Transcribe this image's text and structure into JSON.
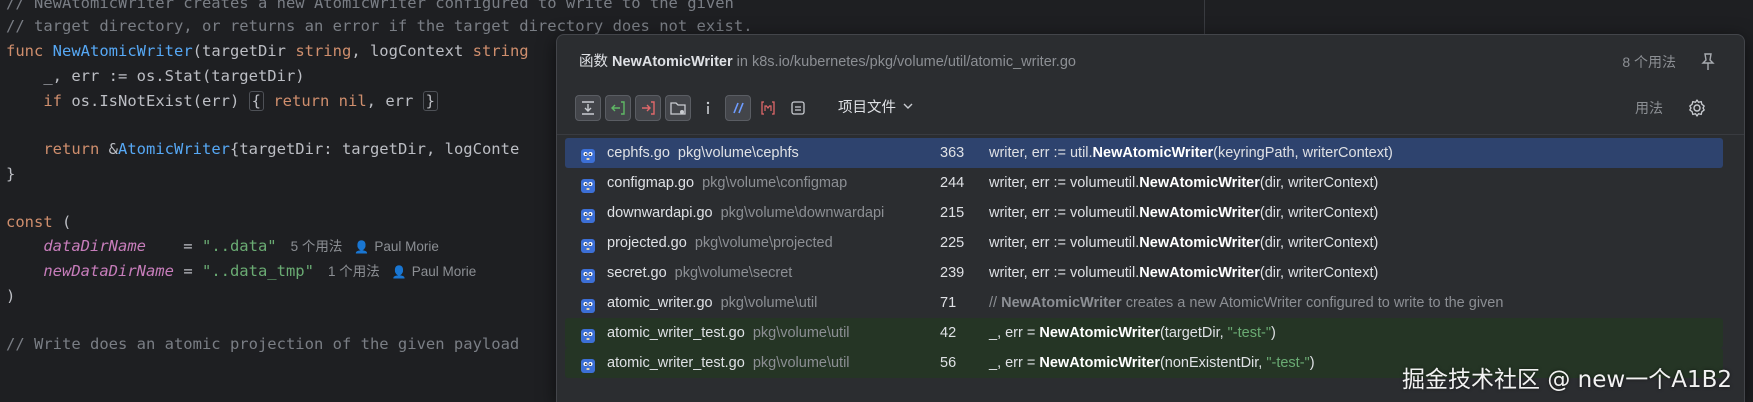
{
  "code": {
    "l1": "// NewAtomicWriter creates a new AtomicWriter configured to write to the given",
    "l2": "// target directory, or returns an error if the target directory does not exist.",
    "l3_kw": "func",
    "l3_fn": "NewAtomicWriter",
    "l3_rest": "(targetDir ",
    "l3_t1": "string",
    "l3_rest2": ", logContext ",
    "l3_t2": "string",
    "l4_a": "_, err := os.Stat(targetDir)",
    "l5_kw": "if",
    "l5_a": " os.IsNotExist(err) ",
    "l5_fold_open": "{",
    "l5_ret": "return",
    "l5_nil": "nil",
    "l5_b": ", err ",
    "l5_fold_close": "}",
    "l7_ret": "return",
    "l7_a": " &",
    "l7_type": "AtomicWriter",
    "l7_b": "{targetDir: targetDir, logConte",
    "l8": "}",
    "l10_kw": "const",
    "l10_b": " (",
    "l11_name": "dataDirName",
    "l11_eq": "    = ",
    "l11_val": "\"..data\"",
    "l11_usage": "5 个用法",
    "l11_author": "Paul Morie",
    "l12_name": "newDataDirName",
    "l12_eq": " = ",
    "l12_val": "\"..data_tmp\"",
    "l12_usage": "1 个用法",
    "l12_author": "Paul Morie",
    "l13": ")",
    "l15": "// Write does an atomic projection of the given payload"
  },
  "popup": {
    "header_prefix": "函数",
    "header_name": "NewAtomicWriter",
    "header_in": "in k8s.io/kubernetes/pkg/volume/util/atomic_writer.go",
    "usage_count": "8 个用法",
    "scope": "项目文件",
    "usage_label": "用法",
    "toolbar_icons": [
      "merge-icon",
      "read-access-icon",
      "write-access-icon",
      "folder-module-icon",
      "import-icon",
      "comment-icon",
      "string-literal-icon",
      "preview-icon"
    ]
  },
  "results": [
    {
      "file": "cephfs.go",
      "dir": "pkg\\volume\\cephfs",
      "line": "363",
      "pre": "writer, err := util.",
      "bold": "NewAtomicWriter",
      "post": "(keyringPath, writerContext)"
    },
    {
      "file": "configmap.go",
      "dir": "pkg\\volume\\configmap",
      "line": "244",
      "pre": "writer, err := volumeutil.",
      "bold": "NewAtomicWriter",
      "post": "(dir, writerContext)"
    },
    {
      "file": "downwardapi.go",
      "dir": "pkg\\volume\\downwardapi",
      "line": "215",
      "pre": "writer, err := volumeutil.",
      "bold": "NewAtomicWriter",
      "post": "(dir, writerContext)"
    },
    {
      "file": "projected.go",
      "dir": "pkg\\volume\\projected",
      "line": "225",
      "pre": "writer, err := volumeutil.",
      "bold": "NewAtomicWriter",
      "post": "(dir, writerContext)"
    },
    {
      "file": "secret.go",
      "dir": "pkg\\volume\\secret",
      "line": "239",
      "pre": "writer, err := volumeutil.",
      "bold": "NewAtomicWriter",
      "post": "(dir, writerContext)"
    },
    {
      "file": "atomic_writer.go",
      "dir": "pkg\\volume\\util",
      "line": "71",
      "pre": "// ",
      "bold": "NewAtomicWriter",
      "post": " creates a new AtomicWriter configured to write to the given"
    },
    {
      "file": "atomic_writer_test.go",
      "dir": "pkg\\volume\\util",
      "line": "42",
      "pre": "_, err = ",
      "bold": "NewAtomicWriter",
      "post": "(targetDir, ",
      "str": "\"-test-\"",
      "end": ")"
    },
    {
      "file": "atomic_writer_test.go",
      "dir": "pkg\\volume\\util",
      "line": "56",
      "pre": "_, err = ",
      "bold": "NewAtomicWriter",
      "post": "(nonExistentDir, ",
      "str": "\"-test-\"",
      "end": ")"
    }
  ],
  "watermark": "掘金技术社区 @ new一个A1B2",
  "colors": {
    "selected_row": "#2e436e",
    "test_row": "#253525",
    "popup_bg": "#2b2d30",
    "editor_bg": "#1e1f22"
  }
}
